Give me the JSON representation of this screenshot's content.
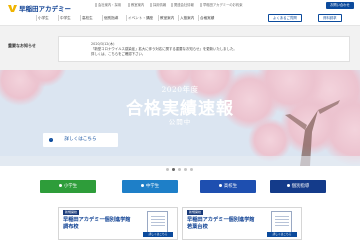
{
  "header": {
    "logo_text": "早稲田アカデミー",
    "util_links": [
      "会社案内・採用",
      "教室案内",
      "採用情報",
      "関連会社情報",
      "早稲田アカデミーのお約束"
    ],
    "util_button": "お問い合わせ",
    "nav_items": [
      "小学生",
      "中学生",
      "高校生",
      "個別指導",
      "イベント・講座",
      "教室案内",
      "入塾案内",
      "合格実績"
    ],
    "nav_buttons": [
      "よくあるご質問",
      "資料請求"
    ]
  },
  "notice": {
    "label": "重要なお知らせ",
    "date": "2020/3/12(木)",
    "text": "「新型コロナウイルス感染症」拡大に伴う対応に関する重要なお知らせ」を更新いたしました。",
    "text2": "詳しくは、こちらをご確認下さい。"
  },
  "hero": {
    "year": "2020年度",
    "title": "合格実績速報",
    "subtitle": "公開中",
    "button_label": "詳しくはこちら"
  },
  "categories": [
    {
      "label": "小学生",
      "color": "#2e9d3a"
    },
    {
      "label": "中学生",
      "color": "#1e7fc8"
    },
    {
      "label": "高校生",
      "color": "#1e4fb0"
    },
    {
      "label": "個別指導",
      "color": "#143b8a"
    }
  ],
  "cards": [
    {
      "tag": "新規開校",
      "title": "早稲田アカデミー個別進学館",
      "title2": "調布校",
      "doc_button": "詳しくはこちら"
    },
    {
      "tag": "新規開校",
      "title": "早稲田アカデミー個別進学館",
      "title2": "若葉台校",
      "doc_button": "詳しくはこちら"
    }
  ],
  "colors": {
    "brand_blue": "#0b4a9c",
    "notice_bg": "#f2f2f2"
  }
}
